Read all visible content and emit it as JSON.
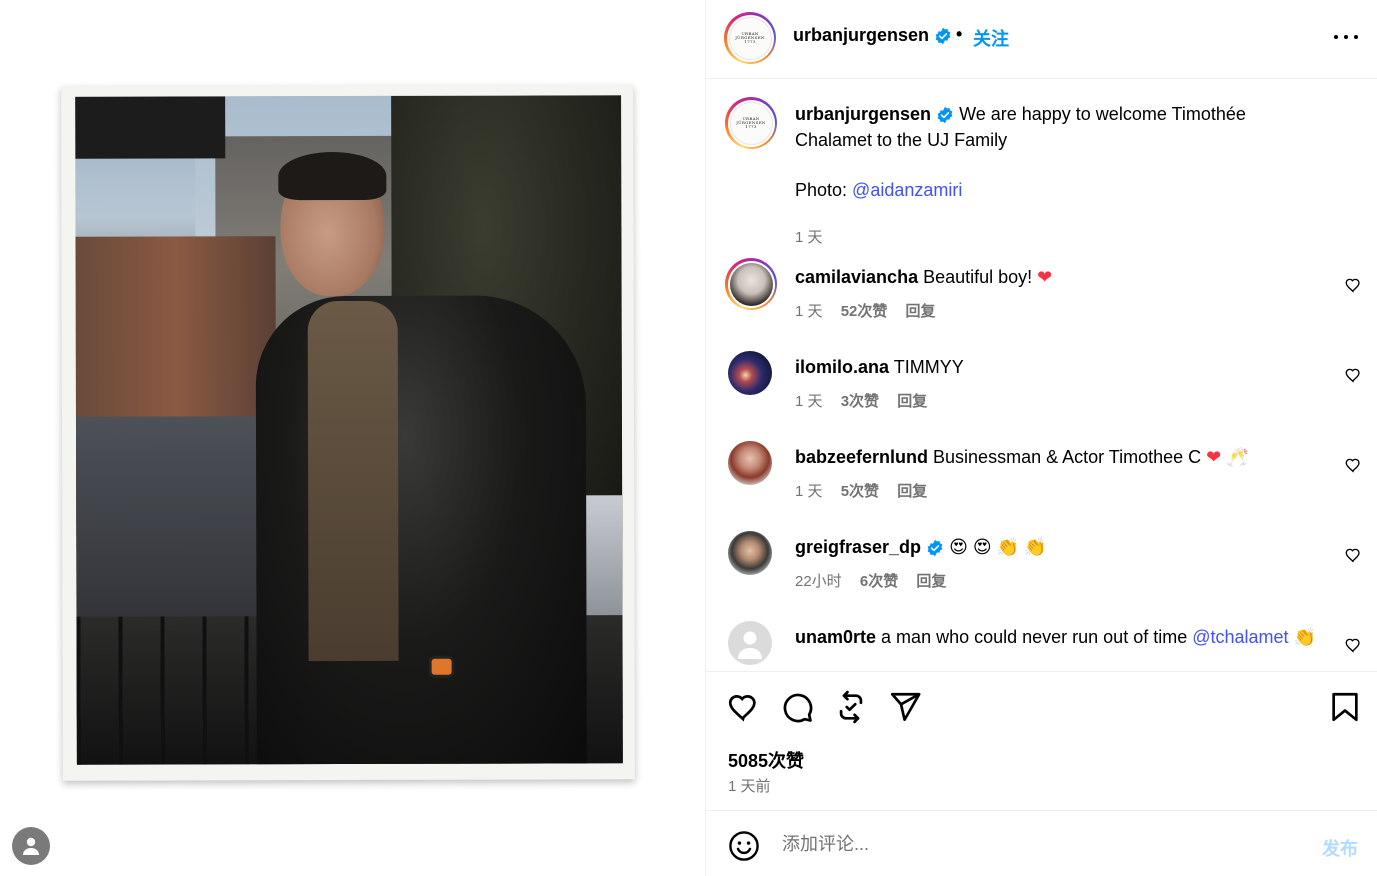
{
  "post": {
    "author": "urbanjurgensen",
    "follow_label": "关注",
    "separator": "•",
    "logo_text": [
      "URBAN",
      "JÜRGENSEN",
      "1773"
    ],
    "caption": "We are happy to welcome Timothée Chalamet to the UJ Family",
    "photo_prefix": "Photo: ",
    "photo_credit": "@aidanzamiri",
    "caption_time": "1 天",
    "likes": "5085次赞",
    "posted_time": "1 天前"
  },
  "comments": [
    {
      "user": "camilaviancha",
      "text": "Beautiful boy! ",
      "emoji": "❤",
      "time": "1 天",
      "likes": "52次赞",
      "reply": "回复",
      "verified": false
    },
    {
      "user": "ilomilo.ana",
      "text": "TIMMYY",
      "emoji": "",
      "time": "1 天",
      "likes": "3次赞",
      "reply": "回复",
      "verified": false
    },
    {
      "user": "babzeefernlund",
      "text": "Businessman & Actor Timothee C ",
      "emoji": "❤ 🥂",
      "time": "1 天",
      "likes": "5次赞",
      "reply": "回复",
      "verified": false
    },
    {
      "user": "greigfraser_dp",
      "text": "",
      "emoji": "😍 😍 👏 👏",
      "time": "22小时",
      "likes": "6次赞",
      "reply": "回复",
      "verified": true
    },
    {
      "user": "unam0rte",
      "text": "a man who could never run out of time ",
      "mention": "@tchalamet",
      "emoji": "👏",
      "time": "",
      "likes": "",
      "reply": "",
      "verified": false
    }
  ],
  "composer": {
    "placeholder": "添加评论...",
    "post_label": "发布"
  },
  "colors": {
    "link": "#4150f7",
    "follow": "#0095f6",
    "verified": "#0095f6",
    "muted": "#737373",
    "post_disabled": "#b3dbff",
    "heart_red": "#ff3040"
  },
  "icons": {
    "header": [
      "verified-badge-icon",
      "more-options-icon"
    ],
    "actions": [
      "like-icon",
      "comment-icon",
      "repost-icon",
      "share-icon",
      "save-icon"
    ],
    "composer": [
      "emoji-icon"
    ],
    "comment_row": [
      "heart-outline-icon"
    ]
  }
}
